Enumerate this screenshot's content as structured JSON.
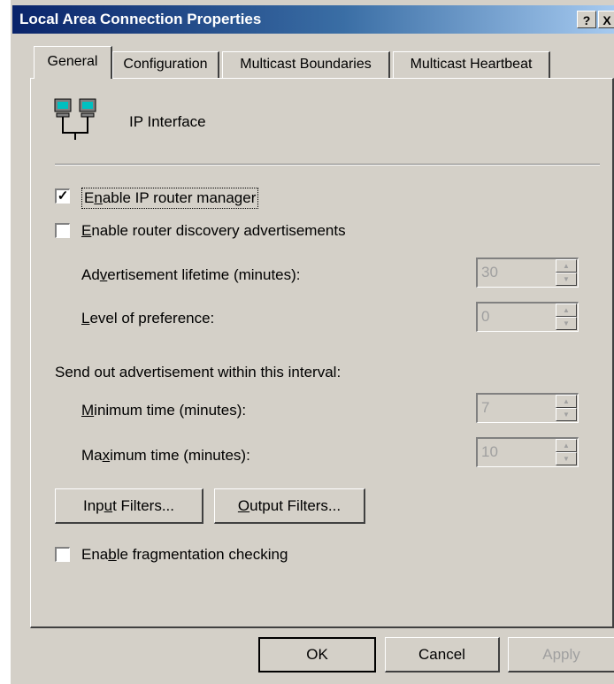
{
  "window": {
    "title": "Local Area Connection Properties",
    "help_glyph": "?",
    "close_glyph": "X"
  },
  "tabs": [
    {
      "label": "General",
      "active": true
    },
    {
      "label": "Configuration",
      "active": false
    },
    {
      "label": "Multicast Boundaries",
      "active": false
    },
    {
      "label": "Multicast Heartbeat",
      "active": false
    }
  ],
  "interface": {
    "label": "IP Interface",
    "icon": "network-computers-icon"
  },
  "options": {
    "enable_router_manager": {
      "pre": "E",
      "key": "n",
      "post": "able IP router manager",
      "checked": true
    },
    "enable_discovery": {
      "pre": "",
      "key": "E",
      "post": "nable router discovery advertisements",
      "checked": false
    },
    "enable_fragmentation": {
      "pre": "Ena",
      "key": "b",
      "post": "le fragmentation checking",
      "checked": false
    }
  },
  "fields": {
    "adv_lifetime": {
      "pre": "Ad",
      "key": "v",
      "post": "ertisement lifetime (minutes):",
      "value": "30"
    },
    "preference": {
      "pre": "",
      "key": "L",
      "post": "evel of preference:",
      "value": "0"
    },
    "interval_heading": "Send out advertisement within this interval:",
    "min_time": {
      "pre": "",
      "key": "M",
      "post": "inimum time (minutes):",
      "value": "7"
    },
    "max_time": {
      "pre": "Ma",
      "key": "x",
      "post": "imum time (minutes):",
      "value": "10"
    }
  },
  "buttons": {
    "input_filters": {
      "pre": "Inp",
      "key": "u",
      "post": "t Filters..."
    },
    "output_filters": {
      "pre": "",
      "key": "O",
      "post": "utput Filters..."
    },
    "ok": "OK",
    "cancel": "Cancel",
    "apply": "Apply"
  },
  "colors": {
    "title_start": "#0a246a",
    "title_end": "#a6caf0",
    "face": "#d4d0c8",
    "disabled": "#a0a0a0"
  }
}
